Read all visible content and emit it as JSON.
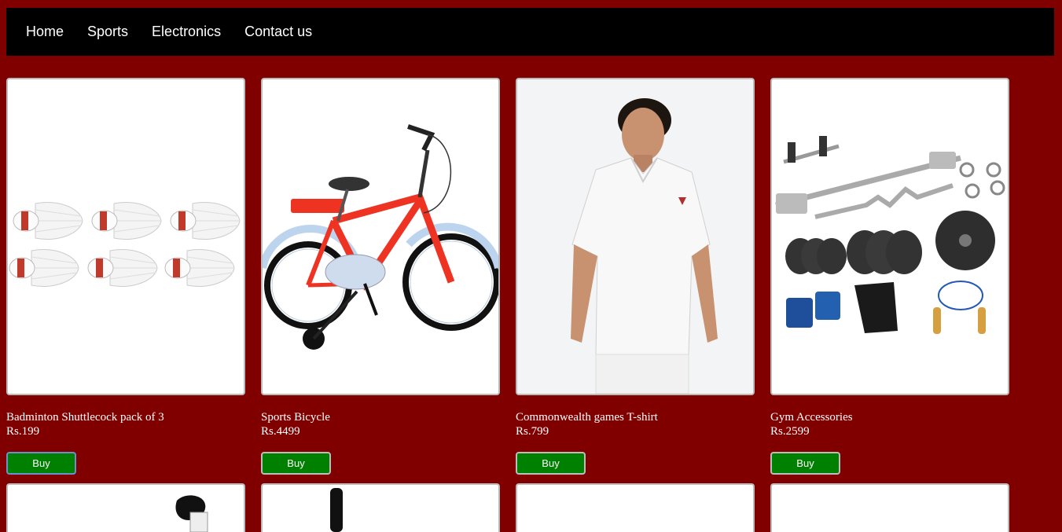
{
  "nav": {
    "items": [
      "Home",
      "Sports",
      "Electronics",
      "Contact us"
    ]
  },
  "products": [
    {
      "title": "Badminton Shuttlecock pack of 3",
      "price": "Rs.199",
      "buy_label": "Buy"
    },
    {
      "title": "Sports Bicycle",
      "price": "Rs.4499",
      "buy_label": "Buy"
    },
    {
      "title": "Commonwealth games T-shirt",
      "price": "Rs.799",
      "buy_label": "Buy"
    },
    {
      "title": "Gym Accessories",
      "price": "Rs.2599",
      "buy_label": "Buy"
    }
  ],
  "colors": {
    "page_bg": "#800000",
    "nav_bg": "#000000",
    "buy_button": "#008000"
  }
}
